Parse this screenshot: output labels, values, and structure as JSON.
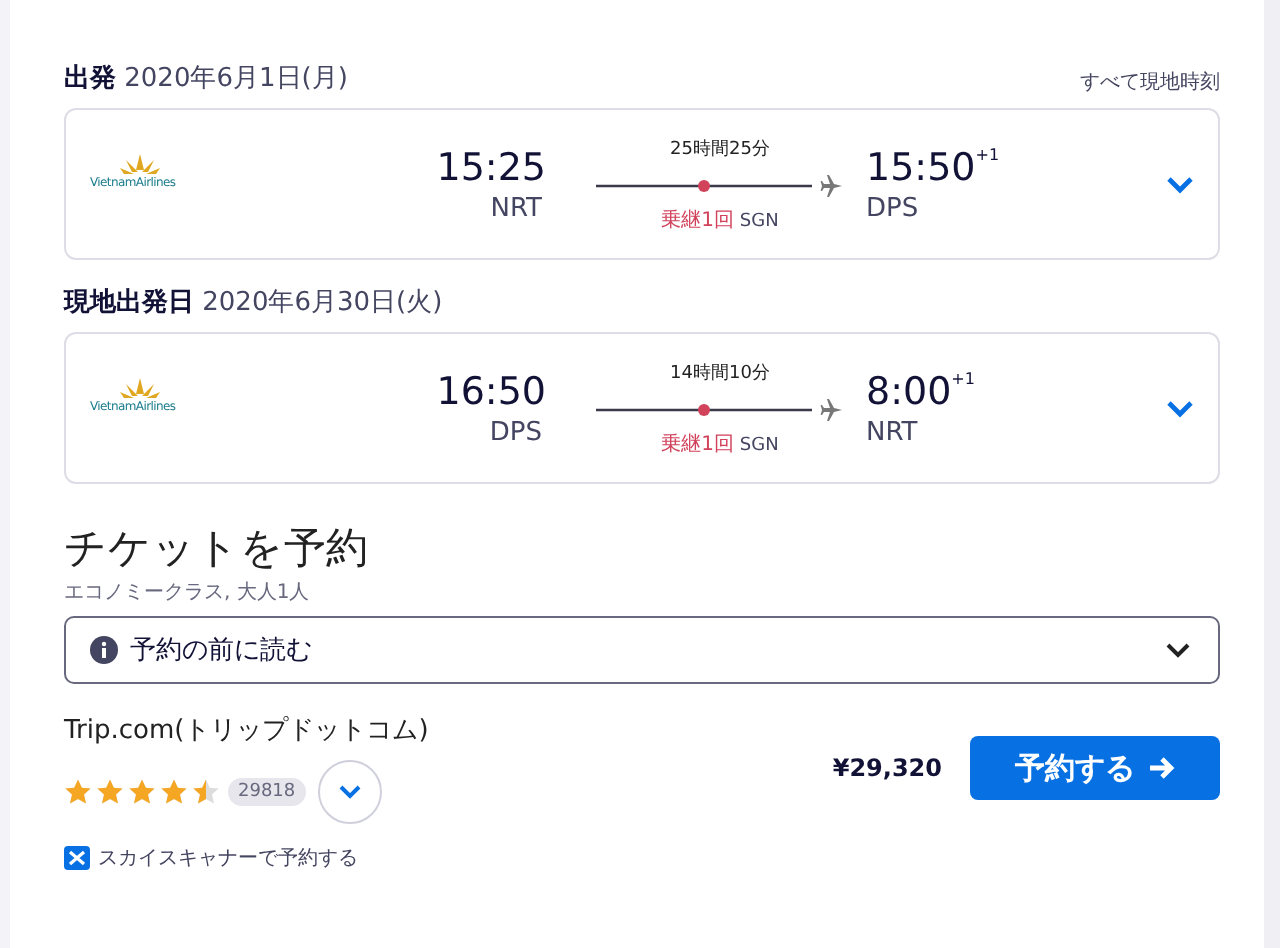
{
  "timezone_note": "すべて現地時刻",
  "legs": [
    {
      "label": "出発",
      "date": "2020年6月1日(月)",
      "airline": "VietnamAirlines",
      "depart_time": "15:25",
      "depart_airport": "NRT",
      "duration": "25時間25分",
      "stops": "乗継1回",
      "via": "SGN",
      "arrive_time": "15:50",
      "day_offset": "+1",
      "arrive_airport": "DPS",
      "expanded": false
    },
    {
      "label": "現地出発日",
      "date": "2020年6月30日(火)",
      "airline": "VietnamAirlines",
      "depart_time": "16:50",
      "depart_airport": "DPS",
      "duration": "14時間10分",
      "stops": "乗継1回",
      "via": "SGN",
      "arrive_time": "8:00",
      "day_offset": "+1",
      "arrive_airport": "NRT",
      "expanded": false
    }
  ],
  "booking": {
    "title": "チケットを予約",
    "subtitle": "エコノミークラス, 大人1人",
    "notice": "予約の前に読む",
    "notice_expanded": false,
    "provider": "Trip.com(トリップドットコム)",
    "stars": 4.5,
    "review_count": "29818",
    "price": "¥29,320",
    "book_button": "予約する",
    "skyscanner_link": "スカイスキャナーで予約する"
  }
}
